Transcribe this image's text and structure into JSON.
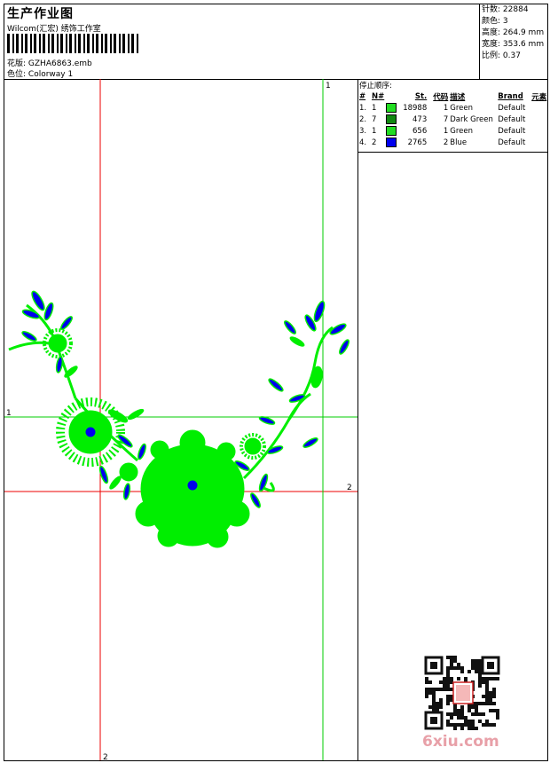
{
  "header": {
    "title": "生产作业图",
    "company": "Wilcom(汇宏) 绣饰工作室",
    "design_label": "花版:",
    "design_value": "GZHA6863.emb",
    "colorway_label": "色位:",
    "colorway_value": "Colorway 1"
  },
  "stats": {
    "stitches_label": "针数:",
    "stitches_value": "22884",
    "colors_label": "颜色:",
    "colors_value": "3",
    "height_label": "高度:",
    "height_value": "264.9 mm",
    "width_label": "宽度:",
    "width_value": "353.6 mm",
    "scale_label": "比例:",
    "scale_value": "0.37"
  },
  "stop_sequence": {
    "title": "停止顺序:",
    "columns": [
      "#",
      "N#",
      "St.",
      "代码",
      "描述",
      "Brand",
      "元素"
    ],
    "rows": [
      {
        "idx": "1.",
        "n": "1",
        "color": "#22dd22",
        "st": "18988",
        "code": "1",
        "desc": "Green",
        "brand": "Default"
      },
      {
        "idx": "2.",
        "n": "7",
        "color": "#118811",
        "st": "473",
        "code": "7",
        "desc": "Dark Green",
        "brand": "Default"
      },
      {
        "idx": "3.",
        "n": "1",
        "color": "#22dd22",
        "st": "656",
        "code": "1",
        "desc": "Green",
        "brand": "Default"
      },
      {
        "idx": "4.",
        "n": "2",
        "color": "#0000ee",
        "st": "2765",
        "code": "2",
        "desc": "Blue",
        "brand": "Default"
      }
    ]
  },
  "guides": {
    "green_v_label": "1",
    "green_h_label": "1",
    "red_h_label": "2",
    "red_v_label": "2"
  },
  "colors": {
    "green": "#00ee00",
    "dark_green": "#118811",
    "blue": "#0000ee",
    "red_guide": "#ee0000",
    "green_guide": "#00cc00"
  },
  "watermark": "6xiu.com"
}
